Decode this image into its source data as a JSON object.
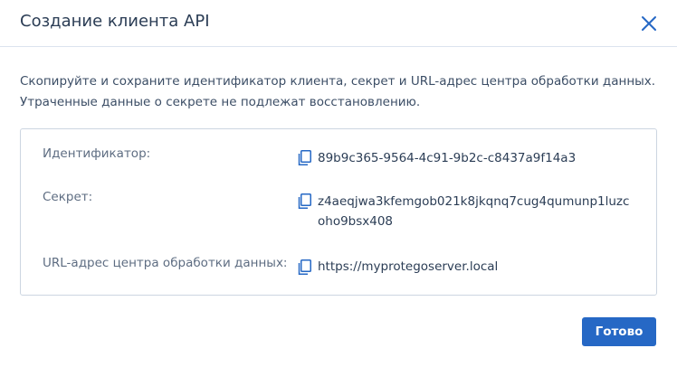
{
  "dialog": {
    "title": "Создание клиента API",
    "description_line1": "Скопируйте и сохраните идентификатор клиента, секрет и URL-адрес центра обработки данных.",
    "description_line2": "Утраченные данные о секрете не подлежат восстановлению.",
    "fields": [
      {
        "label": "Идентификатор:",
        "value": "89b9c365-9564-4c91-9b2c-c8437a9f14a3"
      },
      {
        "label": "Секрет:",
        "value_line1": "z4aeqjwa3kfemgob021k8jkqnq7cug4qumunp1luzc",
        "value_line2": "oho9bsx408"
      },
      {
        "label": "URL-адрес центра обработки данных:",
        "value": "https://myprotegoserver.local"
      }
    ],
    "done_label": "Готово"
  },
  "colors": {
    "accent": "#2668c5",
    "icon": "#2668c5",
    "title_text": "#2b3d55",
    "label_text": "#5e6d82"
  }
}
